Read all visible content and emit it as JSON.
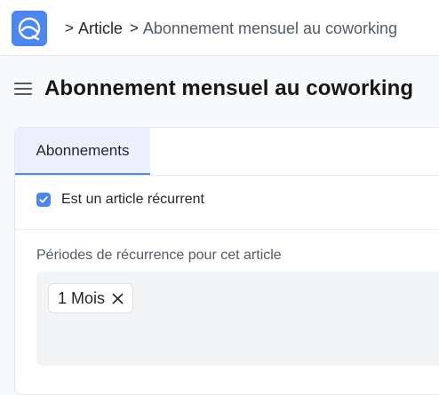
{
  "breadcrumb": {
    "separator": ">",
    "parent": "Article",
    "current": "Abonnement mensuel au coworking"
  },
  "page": {
    "title": "Abonnement mensuel au coworking"
  },
  "tabs": [
    {
      "label": "Abonnements",
      "active": true
    }
  ],
  "form": {
    "recurring_checkbox": {
      "label": "Est un article récurrent",
      "checked": true
    },
    "periods": {
      "label": "Périodes de récurrence pour cet article",
      "selected": [
        {
          "label": "1 Mois"
        }
      ]
    }
  },
  "colors": {
    "accent": "#4c86f0",
    "tab_active_bg": "#eaf1fd",
    "field_bg": "#f3f4f6"
  }
}
